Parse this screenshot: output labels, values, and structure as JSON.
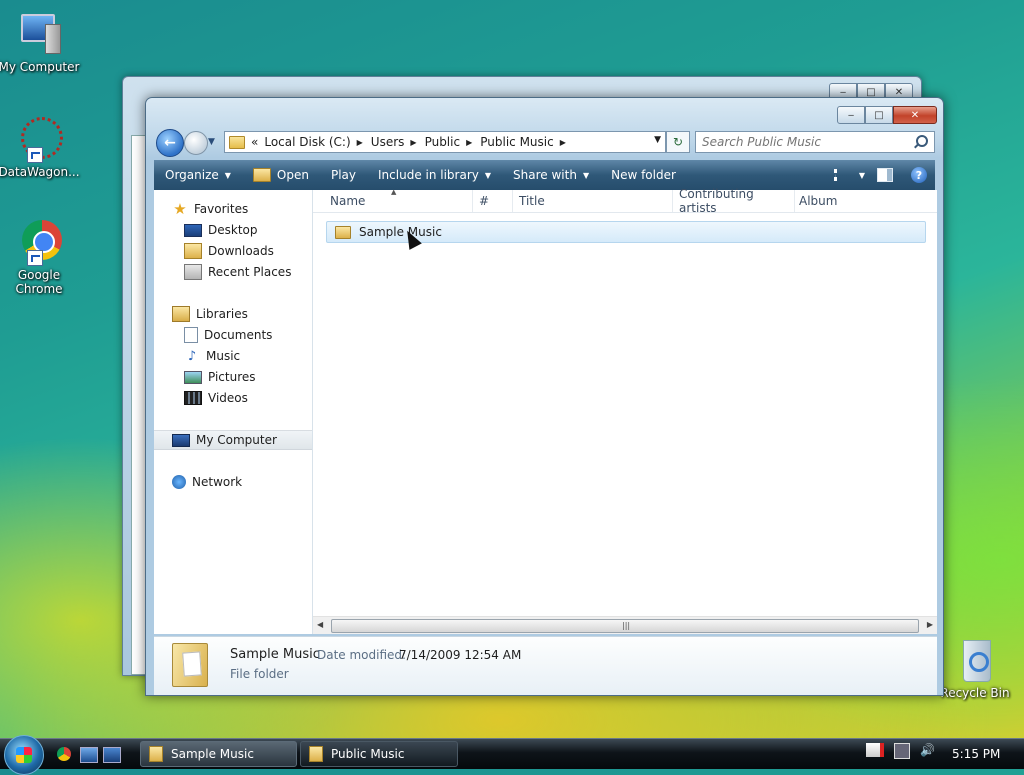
{
  "desktop": {
    "icons": [
      {
        "label": "My Computer"
      },
      {
        "label": "DataWagon..."
      },
      {
        "label": "Google Chrome"
      },
      {
        "label": "Recycle Bin"
      }
    ]
  },
  "window": {
    "title": "Public Music",
    "address": {
      "overflow": "«",
      "crumbs": [
        "Local Disk (C:)",
        "Users",
        "Public",
        "Public Music"
      ]
    },
    "search_placeholder": "Search Public Music",
    "toolbar": {
      "organize": "Organize",
      "open": "Open",
      "play": "Play",
      "include": "Include in library",
      "share": "Share with",
      "new_folder": "New folder"
    },
    "nav": {
      "favorites": "Favorites",
      "desktop": "Desktop",
      "downloads": "Downloads",
      "recent": "Recent Places",
      "libraries": "Libraries",
      "documents": "Documents",
      "music": "Music",
      "pictures": "Pictures",
      "videos": "Videos",
      "computer": "My Computer",
      "network": "Network"
    },
    "columns": [
      "Name",
      "#",
      "Title",
      "Contributing artists",
      "Album"
    ],
    "rows": [
      {
        "name": "Sample Music"
      }
    ],
    "details": {
      "name": "Sample Music",
      "date_label": "Date modified:",
      "date_value": "7/14/2009 12:54 AM",
      "type": "File folder"
    }
  },
  "taskbar": {
    "tasks": [
      "Sample Music",
      "Public Music"
    ],
    "clock": "5:15 PM"
  }
}
